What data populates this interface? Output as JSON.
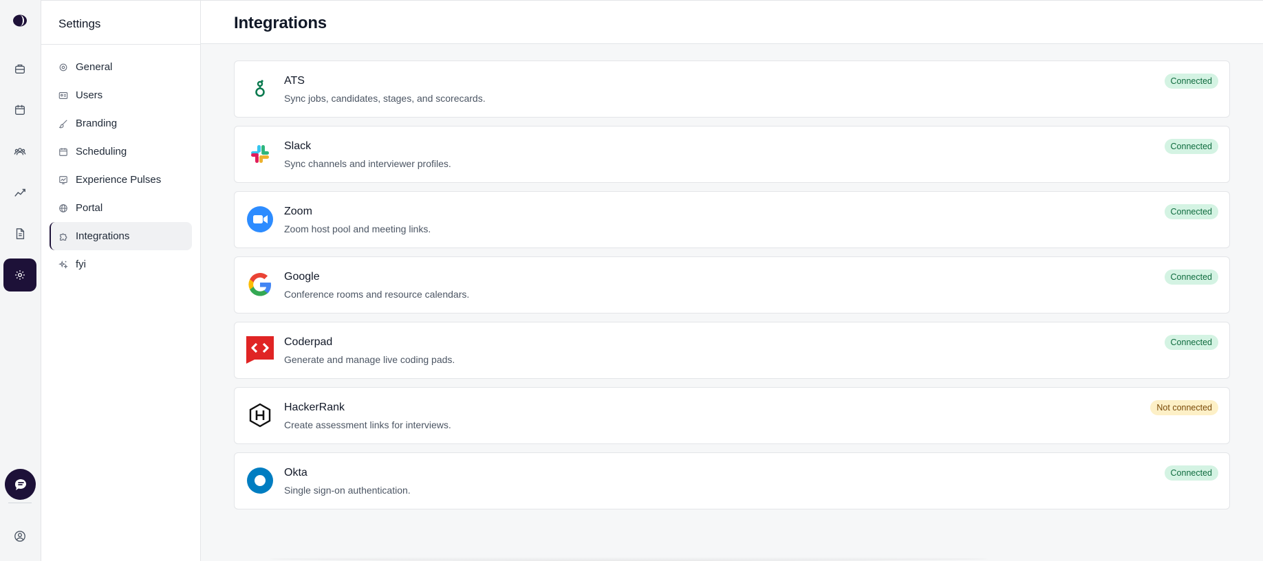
{
  "rail": {
    "icons": [
      "logo-icon",
      "briefcase-icon",
      "calendar-icon",
      "people-icon",
      "chart-icon",
      "document-icon",
      "settings-icon",
      "chat-icon",
      "account-icon"
    ]
  },
  "sidebar": {
    "title": "Settings",
    "items": [
      {
        "label": "General",
        "icon": "gear-icon"
      },
      {
        "label": "Users",
        "icon": "id-card-icon"
      },
      {
        "label": "Branding",
        "icon": "brush-icon"
      },
      {
        "label": "Scheduling",
        "icon": "calendar-icon"
      },
      {
        "label": "Experience Pulses",
        "icon": "pulse-icon"
      },
      {
        "label": "Portal",
        "icon": "globe-icon"
      },
      {
        "label": "Integrations",
        "icon": "puzzle-icon",
        "active": true
      },
      {
        "label": "fyi",
        "icon": "sparkles-icon"
      }
    ]
  },
  "main": {
    "title": "Integrations",
    "integrations": [
      {
        "name": "ATS",
        "description": "Sync jobs, candidates, stages, and scorecards.",
        "status": "Connected",
        "logo": "ats-logo-icon"
      },
      {
        "name": "Slack",
        "description": "Sync channels and interviewer profiles.",
        "status": "Connected",
        "logo": "slack-logo-icon"
      },
      {
        "name": "Zoom",
        "description": "Zoom host pool and meeting links.",
        "status": "Connected",
        "logo": "zoom-logo-icon"
      },
      {
        "name": "Google",
        "description": "Conference rooms and resource calendars.",
        "status": "Connected",
        "logo": "google-logo-icon"
      },
      {
        "name": "Coderpad",
        "description": "Generate and manage live coding pads.",
        "status": "Connected",
        "logo": "coderpad-logo-icon"
      },
      {
        "name": "HackerRank",
        "description": "Create assessment links for interviews.",
        "status": "Not connected",
        "logo": "hackerrank-logo-icon"
      },
      {
        "name": "Okta",
        "description": "Single sign-on authentication.",
        "status": "Connected",
        "logo": "okta-logo-icon"
      }
    ]
  },
  "colors": {
    "accent": "#1d1138",
    "connected_bg": "#d4f3e3",
    "connected_text": "#0f6b3e",
    "not_connected_bg": "#fdf0c7",
    "not_connected_text": "#7a4a07"
  }
}
